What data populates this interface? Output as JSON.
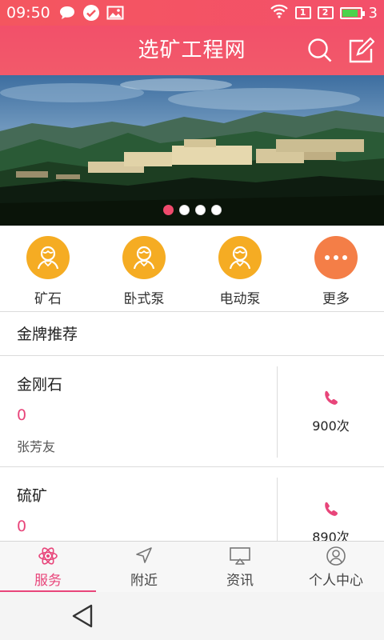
{
  "status_bar": {
    "time": "09:50",
    "sim1": "1",
    "sim2": "2",
    "battery_level": 0.85,
    "battery_text": "3",
    "icons": [
      "chat-icon",
      "check-circle-icon",
      "image-icon",
      "wifi-icon"
    ]
  },
  "header": {
    "title": "选矿工程网",
    "search_icon": "search-icon",
    "edit_icon": "edit-icon"
  },
  "banner": {
    "slide_count": 4,
    "active_index": 0
  },
  "categories": [
    {
      "label": "矿石",
      "icon": "person-icon",
      "color": "#f5ac23"
    },
    {
      "label": "卧式泵",
      "icon": "person-icon",
      "color": "#f5ac23"
    },
    {
      "label": "电动泵",
      "icon": "person-icon",
      "color": "#f5ac23"
    },
    {
      "label": "更多",
      "icon": "more-icon",
      "color": "#f47e47"
    }
  ],
  "section": {
    "title": "金牌推荐"
  },
  "items": [
    {
      "name": "金刚石",
      "count": "0",
      "owner": "张芳友",
      "calls": "900次"
    },
    {
      "name": "硫矿",
      "count": "0",
      "owner": "",
      "calls": "890次"
    }
  ],
  "tabs": [
    {
      "label": "服务",
      "icon": "atom-icon",
      "active": true
    },
    {
      "label": "附近",
      "icon": "navigation-icon",
      "active": false
    },
    {
      "label": "资讯",
      "icon": "cast-icon",
      "active": false
    },
    {
      "label": "个人中心",
      "icon": "user-icon",
      "active": false
    }
  ],
  "colors": {
    "brand": "#f2506a",
    "accent": "#e8457a",
    "category_gold": "#f5ac23",
    "category_orange": "#f47e47"
  }
}
